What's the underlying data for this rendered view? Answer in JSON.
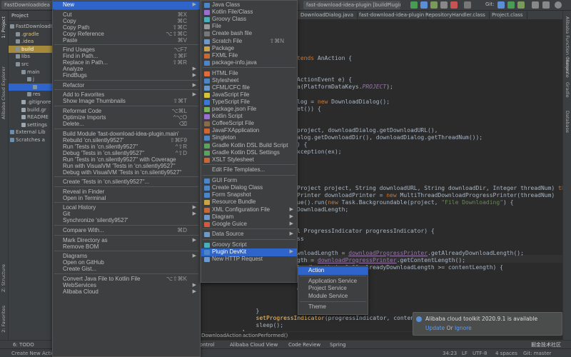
{
  "toolbar": {
    "project_title": "FastDownloadIdea",
    "run_config": "fast-download-idea-plugin [buildPlugin]",
    "git_label": "Git:"
  },
  "editor_tabs": [
    {
      "label": "DownloadDialog.java",
      "active": false
    },
    {
      "label": "fast-download-idea-plugin",
      "active": false
    },
    {
      "label": "RepositoryHandler.class",
      "active": false
    },
    {
      "label": "Project.class",
      "active": false
    }
  ],
  "project_panel": {
    "header": "Project",
    "tree": [
      {
        "label": "FastDownloadId",
        "kind": "root"
      },
      {
        "label": ".gradle",
        "kind": "folder-orange"
      },
      {
        "label": ".idea",
        "kind": "folder-orange"
      },
      {
        "label": "build",
        "kind": "folder-hl"
      },
      {
        "label": "libs",
        "kind": "folder"
      },
      {
        "label": "src",
        "kind": "folder"
      },
      {
        "label": "main",
        "kind": "folder"
      },
      {
        "label": "j",
        "kind": "folder"
      },
      {
        "label": "",
        "kind": "selected"
      },
      {
        "label": "res",
        "kind": "folder"
      },
      {
        "label": ".gitignore",
        "kind": "file"
      },
      {
        "label": "build.gr",
        "kind": "file"
      },
      {
        "label": "README",
        "kind": "file"
      },
      {
        "label": "settings",
        "kind": "file"
      },
      {
        "label": "External Lib",
        "kind": "lib"
      },
      {
        "label": "Scratches a",
        "kind": "lib"
      }
    ]
  },
  "left_tabs": [
    "1: Project",
    "Alibaba Cloud Explorer",
    "Z: Structure",
    "2: Favorites"
  ],
  "right_tabs": [
    "Alibaba Function Compute",
    "Maven",
    "Gradle",
    "Database"
  ],
  "code_lines": [
    "tends AnAction {",
    "",
    "",
    "ActionEvent e) {",
    "a(PlatformDataKeys.PROJECT);",
    "",
    "log = new DownloadDialog();",
    "et()) {",
    "",
    "",
    "project, downloadDialog.getDownloadURL(),",
    "alog.getDownloadDir(), downloadDialog.getThreadNum());",
    ") {",
    "xception(ex);",
    "",
    "",
    "",
    "",
    "Project project, String downloadURL, String downloadDir, Integer threadNum) throws",
    "Printer downloadPrinter = new MultiThreadDownloadProgressPrinter(threadNum)",
    "ue().run(new Task.Backgroundable(project, \"File Downloading\") {",
    "DownloadLength;",
    "",
    "",
    "l ProgressIndicator progressIndicator) {",
    "ss",
    "",
    "wnloadLength = downloadProgressPrinter.getAlreadyDownloadLength();",
    "gth = downloadProgressPrinter.getContentLength();",
    "loadLength != 0 && alreadyDownloadLength >= contentLength) {",
    "",
    "",
    "ed\");",
    "",
    "",
    "        }",
    "        setProgressIndicator(progressIndicator, contentLength, alreadyDownloadLength);",
    "        sleep();",
    "    }",
    "}",
    "",
    "private void setProgressIndicator(ProgressIndicator progres"
  ],
  "breadcrumb": [
    "DownloadAction",
    "actionPerformed()"
  ],
  "bottom_tabs": [
    "6: TODO",
    "ontrol",
    "Alibaba Cloud View",
    "Code Review",
    "Spring"
  ],
  "status": {
    "left": "Create New Action",
    "position": "34:23",
    "line_sep": "LF",
    "encoding": "UTF-8",
    "indent": "4 spaces",
    "branch": "Git: master"
  },
  "notification": {
    "title": "Alibaba cloud toolkit 2020.9.1 is available",
    "update": "Update",
    "or": "Or",
    "ignore": "Ignore"
  },
  "watermark": "掘金技术社区",
  "menu1": [
    {
      "label": "New",
      "arrow": true,
      "selected": true
    },
    {
      "sep": true
    },
    {
      "label": "Cut",
      "shortcut": "⌘X"
    },
    {
      "label": "Copy",
      "shortcut": "⌘C"
    },
    {
      "label": "Copy Path",
      "shortcut": "⇧⌘C"
    },
    {
      "label": "Copy Reference",
      "shortcut": "⌥⇧⌘C"
    },
    {
      "label": "Paste",
      "shortcut": "⌘V"
    },
    {
      "sep": true
    },
    {
      "label": "Find Usages",
      "shortcut": "⌥F7"
    },
    {
      "label": "Find in Path...",
      "shortcut": "⇧⌘F"
    },
    {
      "label": "Replace in Path...",
      "shortcut": "⇧⌘R"
    },
    {
      "label": "Analyze",
      "arrow": true
    },
    {
      "label": "FindBugs",
      "arrow": true
    },
    {
      "sep": true
    },
    {
      "label": "Refactor",
      "arrow": true
    },
    {
      "sep": true
    },
    {
      "label": "Add to Favorites",
      "arrow": true
    },
    {
      "label": "Show Image Thumbnails",
      "shortcut": "⇧⌘T"
    },
    {
      "sep": true
    },
    {
      "label": "Reformat Code",
      "shortcut": "⌥⌘L"
    },
    {
      "label": "Optimize Imports",
      "shortcut": "^⌥O"
    },
    {
      "label": "Delete...",
      "shortcut": "⌫"
    },
    {
      "sep": true
    },
    {
      "label": "Build Module 'fast-download-idea-plugin.main'"
    },
    {
      "label": "Rebuild 'cn.silently9527'",
      "shortcut": "⇧⌘F9"
    },
    {
      "label": "Run 'Tests in 'cn.silently9527''",
      "shortcut": "^⇧R"
    },
    {
      "label": "Debug 'Tests in 'cn.silently9527''",
      "shortcut": "^⇧D"
    },
    {
      "label": "Run 'Tests in 'cn.silently9527'' with Coverage"
    },
    {
      "label": "Run with VisualVM 'Tests in 'cn.silently9527''"
    },
    {
      "label": "Debug with VisualVM 'Tests in 'cn.silently9527''"
    },
    {
      "sep": true
    },
    {
      "label": "Create 'Tests in 'cn.silently9527''..."
    },
    {
      "sep": true
    },
    {
      "label": "Reveal in Finder"
    },
    {
      "label": "Open in Terminal"
    },
    {
      "sep": true
    },
    {
      "label": "Local History",
      "arrow": true
    },
    {
      "label": "Git",
      "arrow": true
    },
    {
      "label": "Synchronize 'silently9527'"
    },
    {
      "sep": true
    },
    {
      "label": "Compare With...",
      "shortcut": "⌘D"
    },
    {
      "sep": true
    },
    {
      "label": "Mark Directory as",
      "arrow": true
    },
    {
      "label": "Remove BOM"
    },
    {
      "sep": true
    },
    {
      "label": "Diagrams",
      "arrow": true
    },
    {
      "label": "Open on GitHub"
    },
    {
      "label": "Create Gist..."
    },
    {
      "sep": true
    },
    {
      "label": "Convert Java File to Kotlin File",
      "shortcut": "⌥⇧⌘K"
    },
    {
      "label": "WebServices",
      "arrow": true
    },
    {
      "label": "Alibaba Cloud",
      "arrow": true
    }
  ],
  "menu2": [
    {
      "label": "Java Class",
      "icon": "#4a86c8"
    },
    {
      "label": "Kotlin File/Class",
      "icon": "#9a6fd1"
    },
    {
      "label": "Groovy Class",
      "icon": "#4ab0b8"
    },
    {
      "label": "File",
      "icon": "#999999"
    },
    {
      "label": "Create bash file",
      "icon": "#777777"
    },
    {
      "label": "Scratch File",
      "icon": "#6a9ad0",
      "shortcut": "⇧⌘N"
    },
    {
      "label": "Package",
      "icon": "#c9a449"
    },
    {
      "label": "FXML File",
      "icon": "#cc6633"
    },
    {
      "label": "package-info.java",
      "icon": "#4a86c8"
    },
    {
      "sep": true
    },
    {
      "label": "HTML File",
      "icon": "#e06c3c"
    },
    {
      "label": "Stylesheet",
      "icon": "#4a86c8"
    },
    {
      "label": "CFML/CFC file",
      "icon": "#6699cc"
    },
    {
      "label": "JavaScript File",
      "icon": "#d6c33a"
    },
    {
      "label": "TypeScript File",
      "icon": "#3a7ad6"
    },
    {
      "label": "package.json File",
      "icon": "#7ab35a"
    },
    {
      "label": "Kotlin Script",
      "icon": "#9a6fd1"
    },
    {
      "label": "CoffeeScript File",
      "icon": "#8a6a4a"
    },
    {
      "label": "JavaFXApplication",
      "icon": "#cc6633"
    },
    {
      "label": "Singleton",
      "icon": "#4a86c8"
    },
    {
      "label": "Gradle Kotlin DSL Build Script",
      "icon": "#5aa35a"
    },
    {
      "label": "Gradle Kotlin DSL Settings",
      "icon": "#5aa35a"
    },
    {
      "label": "XSLT Stylesheet",
      "icon": "#cc6633"
    },
    {
      "sep": true
    },
    {
      "label": "Edit File Templates..."
    },
    {
      "sep": true
    },
    {
      "label": "GUI Form",
      "icon": "#4a86c8"
    },
    {
      "label": "Create Dialog Class",
      "icon": "#4a86c8"
    },
    {
      "label": "Form Snapshot",
      "icon": "#4a86c8"
    },
    {
      "label": "Resource Bundle",
      "icon": "#c9a449"
    },
    {
      "label": "XML Configuration File",
      "icon": "#cc6633",
      "arrow": true
    },
    {
      "label": "Diagram",
      "icon": "#6a9ad0",
      "arrow": true
    },
    {
      "label": "Google Guice",
      "icon": "#d65a3a",
      "arrow": true
    },
    {
      "sep": true
    },
    {
      "label": "Data Source",
      "icon": "#6a9ad0",
      "arrow": true
    },
    {
      "sep": true
    },
    {
      "label": "Groovy Script",
      "icon": "#4ab0b8"
    },
    {
      "label": "Plugin DevKit",
      "icon": "#4a86c8",
      "arrow": true,
      "selected": true
    },
    {
      "label": "New HTTP Request",
      "icon": "#6a9ad0"
    }
  ],
  "menu3": [
    {
      "label": "Action",
      "selected": true
    },
    {
      "sep": true
    },
    {
      "label": "Application Service"
    },
    {
      "label": "Project Service"
    },
    {
      "label": "Module Service"
    },
    {
      "sep": true
    },
    {
      "label": "Theme"
    }
  ]
}
